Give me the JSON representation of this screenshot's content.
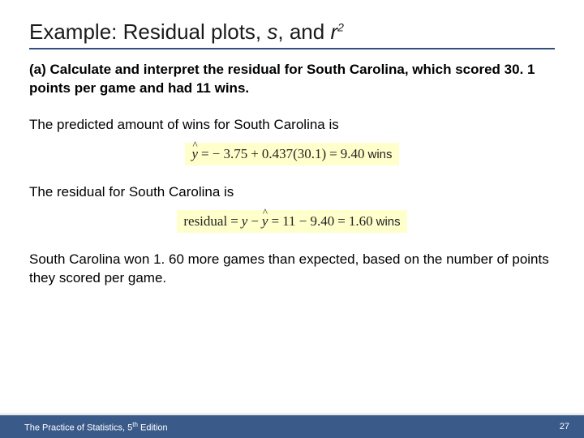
{
  "title": {
    "prefix": "Example: Residual plots, ",
    "var1": "s",
    "sep": ", and ",
    "var2": "r",
    "exp": "2"
  },
  "question": "(a) Calculate and interpret the residual for South Carolina, which scored 30. 1 points per game and had 11 wins.",
  "line1": "The predicted amount of wins for South Carolina is",
  "eq1": {
    "lhs": "ŷ",
    "rhs_a": "− 3.75",
    "rhs_b": "0.437(30.1)",
    "result": "9.40",
    "unit": "wins"
  },
  "line2": "The residual for South Carolina is",
  "eq2": {
    "label": "residual",
    "expr_sym": "y − ŷ",
    "expr_num": "11 − 9.40",
    "result": "1.60",
    "unit": "wins"
  },
  "conclusion": "South Carolina won 1. 60 more games than expected, based on the number of points they scored per game.",
  "footer": {
    "book_prefix": "The Practice of Statistics, 5",
    "book_sup": "th",
    "book_suffix": " Edition",
    "page": "27"
  }
}
